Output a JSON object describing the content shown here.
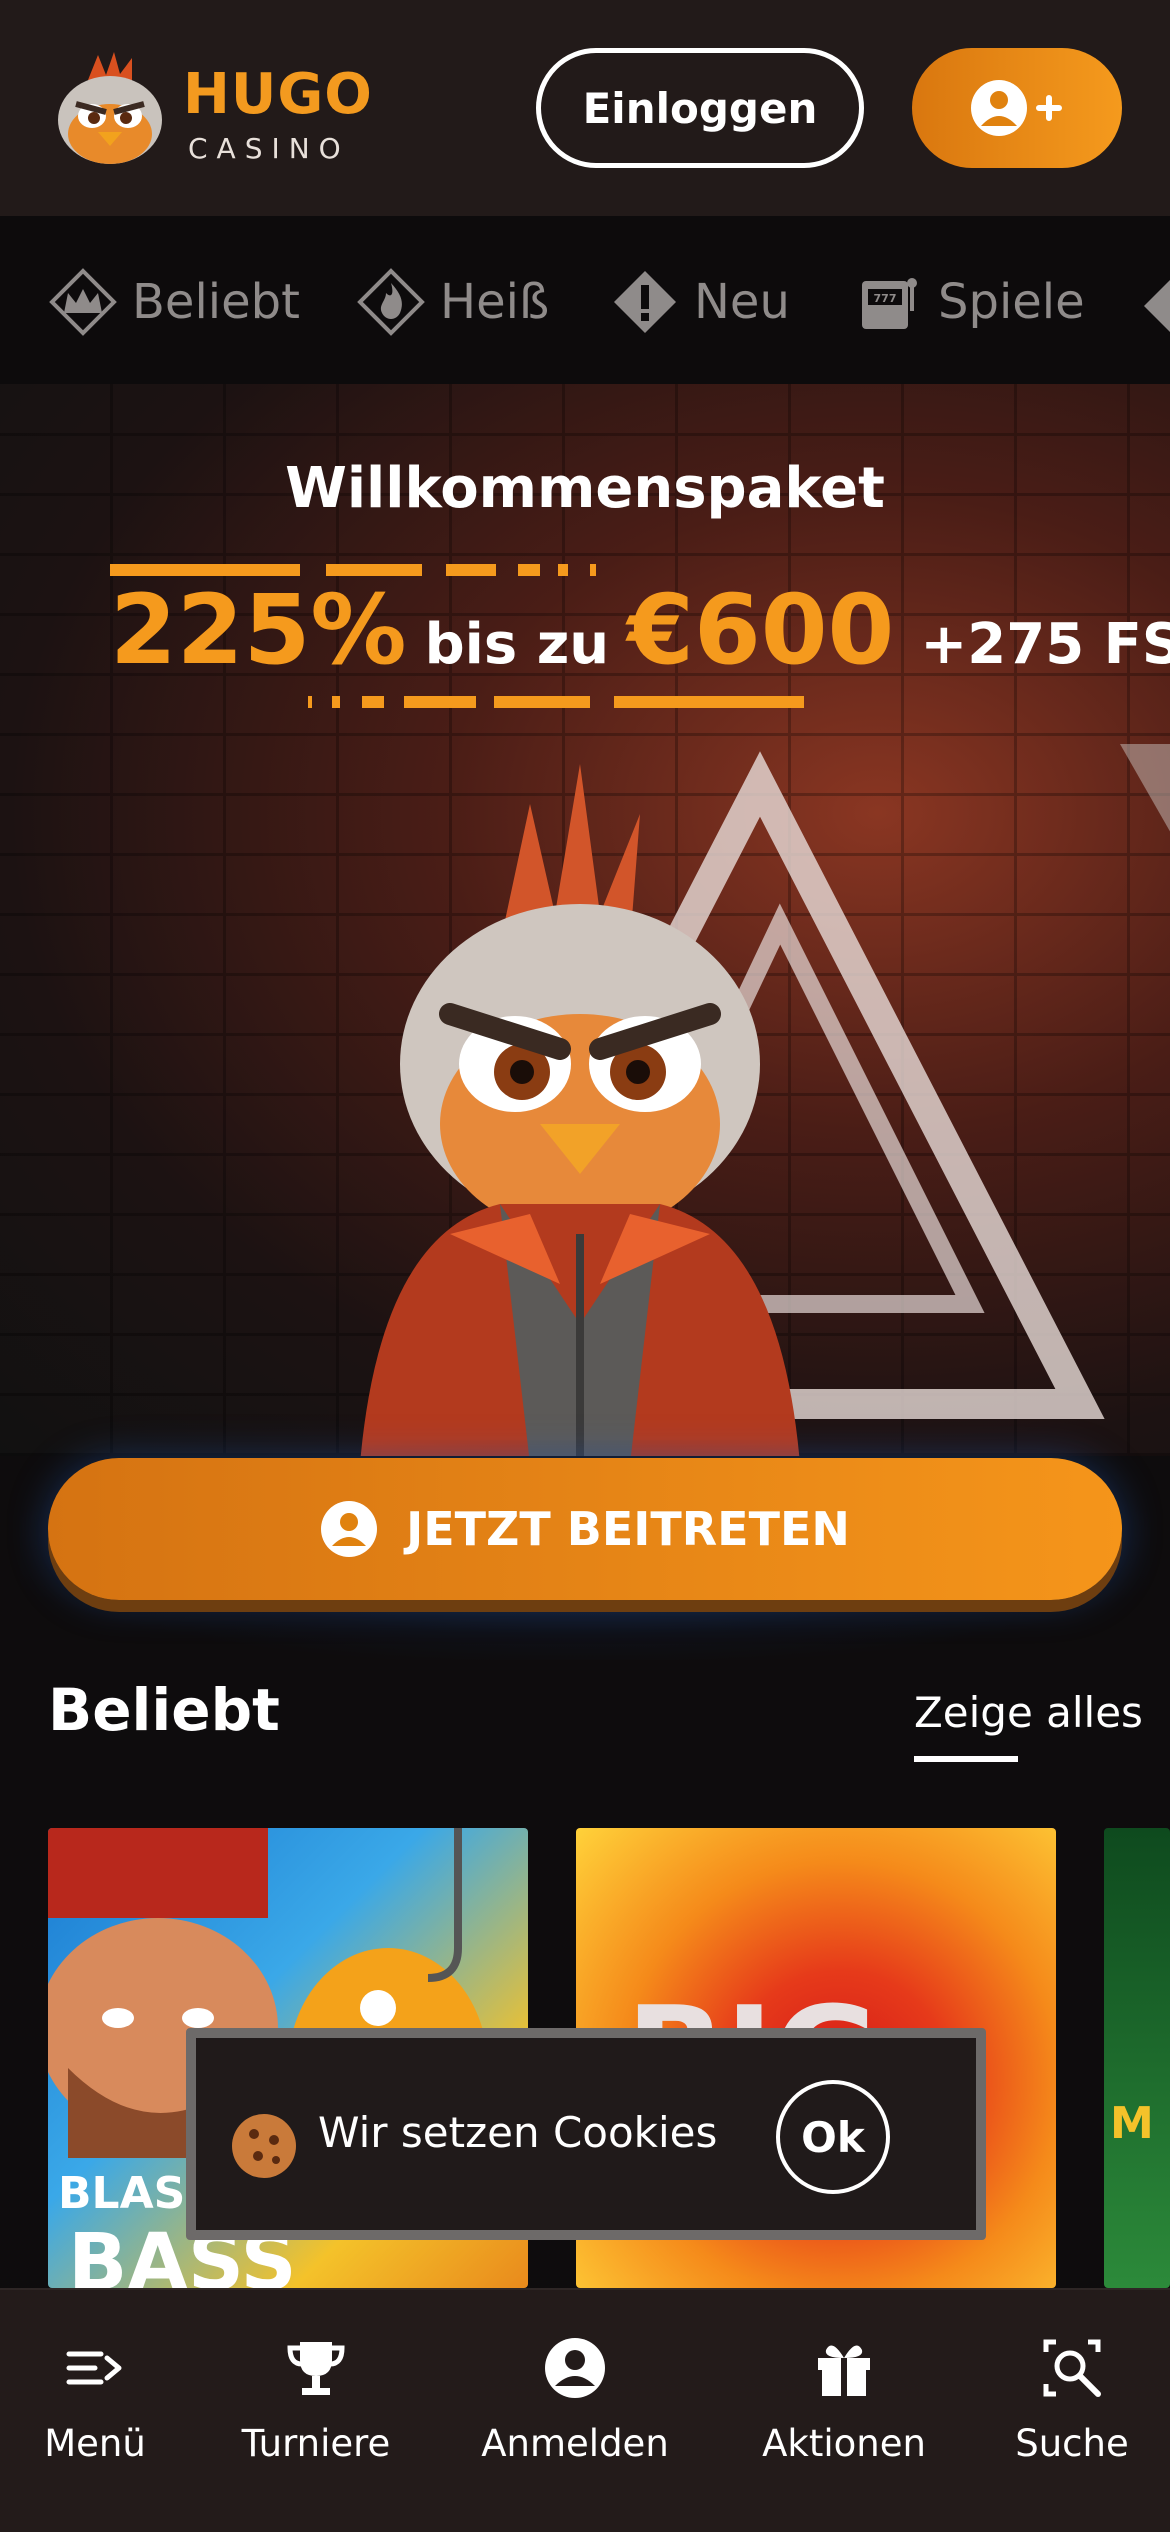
{
  "header": {
    "logo_line1": "HUGO",
    "logo_line2": "CASINO",
    "login_label": "Einloggen",
    "register_icon": "user-plus-icon"
  },
  "categories": [
    {
      "label": "Beliebt",
      "icon": "crown-icon"
    },
    {
      "label": "Heiß",
      "icon": "flame-icon"
    },
    {
      "label": "Neu",
      "icon": "exclamation-icon"
    },
    {
      "label": "Spiele",
      "icon": "slot-machine-icon"
    }
  ],
  "hero": {
    "title": "Willkommenspaket",
    "percent": "225%",
    "middle": "bis zu",
    "amount": "€600",
    "free_spins": "+275 FS"
  },
  "join_label": "JETZT BEITRETEN",
  "section": {
    "title": "Beliebt",
    "link": "Zeige alles"
  },
  "games": [
    {
      "label_top": "BLAS",
      "label_bottom": "BASS"
    },
    {
      "label_top": "BIG",
      "label_bottom": ""
    },
    {
      "label_top": "M",
      "label_bottom": ""
    }
  ],
  "cookie": {
    "text": "Wir setzen Cookies",
    "ok_label": "Ok"
  },
  "bottom_nav": [
    {
      "label": "Menü",
      "icon": "menu-icon"
    },
    {
      "label": "Turniere",
      "icon": "trophy-icon"
    },
    {
      "label": "Anmelden",
      "icon": "user-icon"
    },
    {
      "label": "Aktionen",
      "icon": "gift-icon"
    },
    {
      "label": "Suche",
      "icon": "search-icon"
    }
  ],
  "colors": {
    "accent": "#f59a1d",
    "header_bg": "#221a19",
    "page_bg": "#0e0c0d"
  }
}
